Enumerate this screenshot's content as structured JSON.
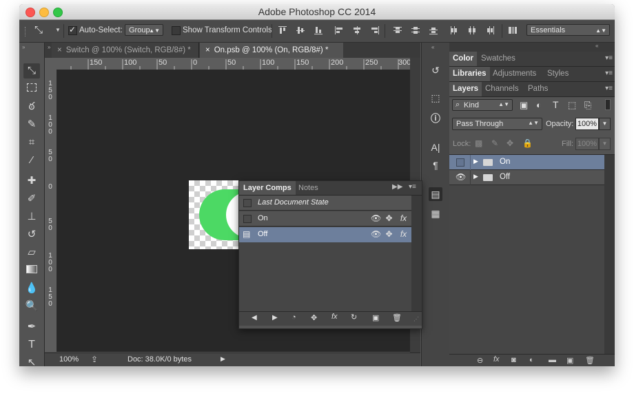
{
  "window": {
    "title": "Adobe Photoshop CC 2014",
    "traffic_colors": [
      "#fc5753",
      "#fdbc40",
      "#33c748"
    ]
  },
  "options_bar": {
    "auto_select_label": "Auto-Select:",
    "auto_select_value": "Group",
    "show_transform_label": "Show Transform Controls",
    "workspace_value": "Essentials"
  },
  "doc_tabs": [
    {
      "label": "Switch @ 100% (Switch, RGB/8#) *",
      "active": false
    },
    {
      "label": "On.psb @ 100% (On, RGB/8#) *",
      "active": true
    }
  ],
  "ruler": {
    "top_labels": [
      "150",
      "100",
      "50",
      "0",
      "50",
      "100",
      "150",
      "200",
      "250",
      "300"
    ],
    "left_labels": [
      "150",
      "100",
      "50",
      "0",
      "50",
      "100",
      "150"
    ]
  },
  "status": {
    "zoom": "100%",
    "doc_info": "Doc: 38.0K/0 bytes"
  },
  "right_panel": {
    "group1_tabs": [
      "Color",
      "Swatches"
    ],
    "group2_tabs": [
      "Libraries",
      "Adjustments",
      "Styles"
    ],
    "group3_tabs": [
      "Layers",
      "Channels",
      "Paths"
    ],
    "filter_kind": "Kind",
    "blend_mode": "Pass Through",
    "opacity_label": "Opacity:",
    "opacity_value": "100%",
    "lock_label": "Lock:",
    "fill_label": "Fill:",
    "fill_value": "100%",
    "layers": [
      {
        "name": "On",
        "visible": false,
        "selected": true
      },
      {
        "name": "Off",
        "visible": true,
        "selected": false
      }
    ]
  },
  "layer_comps_panel": {
    "tabs": [
      "Layer Comps",
      "Notes"
    ],
    "last_state": "Last Document State",
    "comps": [
      {
        "name": "On",
        "selected": false
      },
      {
        "name": "Off",
        "selected": true
      }
    ]
  },
  "colors": {
    "selection": "#6d7f9c",
    "switch_green": "#4cd964",
    "canvas_bg": "#282828"
  }
}
